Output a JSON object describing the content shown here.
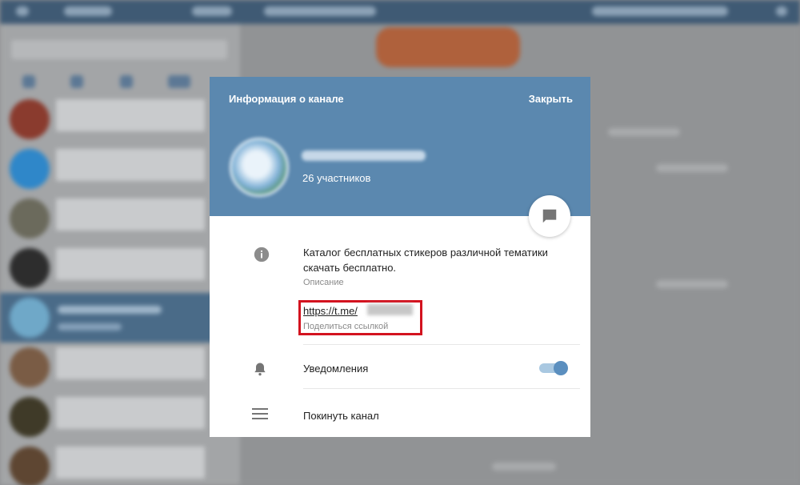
{
  "modal": {
    "title": "Информация о канале",
    "close_label": "Закрыть",
    "channel": {
      "members": "26 участников"
    },
    "description": {
      "text": "Каталог бесплатных стикеров различной тематики скачать бесплатно.",
      "label": "Описание"
    },
    "link": {
      "url_visible": "https://t.me/",
      "label": "Поделиться ссылкой",
      "highlight_color": "#d3131f"
    },
    "notifications": {
      "label": "Уведомления",
      "enabled": true
    },
    "leave_label": "Покинуть канал",
    "icons": {
      "description": "info-icon",
      "notifications": "bell-icon",
      "leave": "menu-icon",
      "message": "chat-bubble-icon"
    },
    "colors": {
      "header": "#5b88af",
      "accent": "#5b8fbf"
    }
  }
}
